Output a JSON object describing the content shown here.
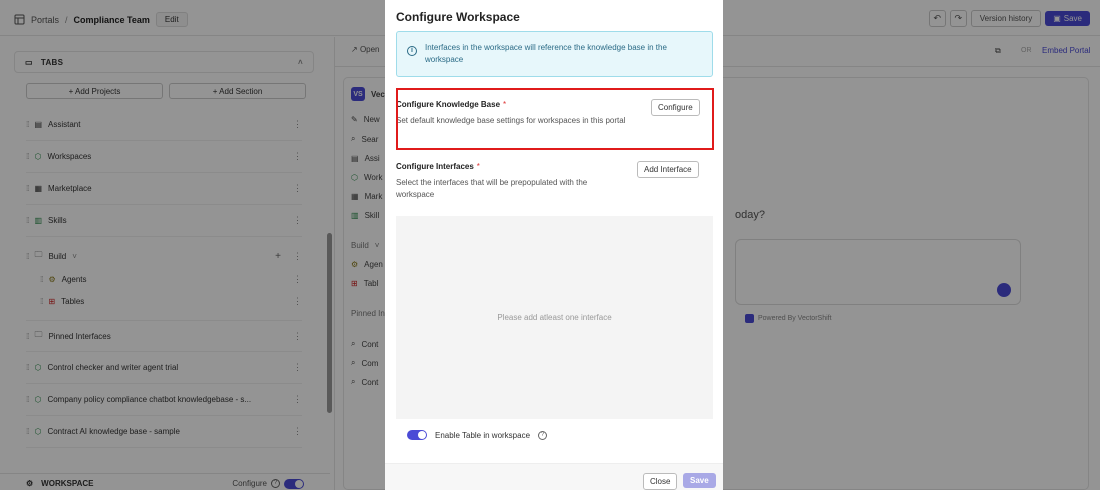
{
  "topbar": {
    "crumb_root": "Portals",
    "crumb_sep": "/",
    "crumb_current": "Compliance Team",
    "edit_label": "Edit",
    "version_history_label": "Version history",
    "save_label": "Save"
  },
  "left": {
    "tabs_header": "TABS",
    "add_projects": "+ Add Projects",
    "add_section": "+ Add Section",
    "items": [
      {
        "label": "Assistant",
        "icon": "chat-icon"
      },
      {
        "label": "Workspaces",
        "icon": "cube-icon"
      },
      {
        "label": "Marketplace",
        "icon": "store-icon"
      },
      {
        "label": "Skills",
        "icon": "book-icon"
      },
      {
        "label": "Build",
        "icon": "folder-icon"
      },
      {
        "label": "Agents",
        "icon": "agent-icon"
      },
      {
        "label": "Tables",
        "icon": "table-icon"
      },
      {
        "label": "Pinned Interfaces",
        "icon": "folder-icon"
      },
      {
        "label": "Control checker and writer agent trial",
        "icon": "cube-icon"
      },
      {
        "label": "Company policy compliance chatbot knowledgebase - s...",
        "icon": "cube-icon"
      },
      {
        "label": "Contract AI knowledge base - sample",
        "icon": "cube-icon"
      }
    ],
    "workspace_label": "WORKSPACE",
    "workspace_configure": "Configure"
  },
  "mid": {
    "open_label": "Open",
    "embed_label": "Embed Portal",
    "ofr_label": "OR",
    "badge": "VS",
    "badge_title": "Vec",
    "menu": [
      "New",
      "Sear",
      "Assi",
      "Work",
      "Mark",
      "Skill"
    ],
    "build_label": "Build",
    "build_items": [
      "Agen",
      "Tabl"
    ],
    "pinned_label": "Pinned In",
    "pinned_items": [
      "Cont",
      "Com",
      "Cont"
    ],
    "today_text": "oday?",
    "powered_by": "Powered By VectorShift"
  },
  "modal": {
    "title": "Configure Workspace",
    "info": "Interfaces in the workspace will reference the knowledge base in the workspace",
    "kb_title": "Configure Knowledge Base",
    "kb_desc": "Set default knowledge base settings for workspaces in this portal",
    "kb_button": "Configure",
    "if_title": "Configure Interfaces",
    "if_desc": "Select the interfaces that will be prepopulated with the workspace",
    "if_button": "Add Interface",
    "empty_text": "Please add atleast one interface",
    "enable_table": "Enable Table in workspace",
    "close": "Close",
    "save": "Save"
  },
  "colors": {
    "accent": "#4b4bd6",
    "highlight": "#e01b1b",
    "info_bg": "#e7f7fb"
  }
}
